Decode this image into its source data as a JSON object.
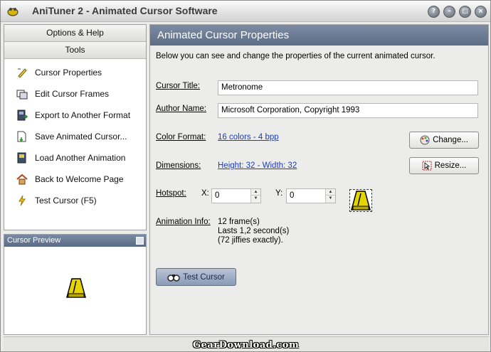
{
  "window": {
    "title": "AniTuner 2 - Animated Cursor Software"
  },
  "sidebar": {
    "header_options": "Options & Help",
    "header_tools": "Tools",
    "items": [
      {
        "label": "Cursor Properties",
        "icon": "properties-icon"
      },
      {
        "label": "Edit Cursor Frames",
        "icon": "frames-icon"
      },
      {
        "label": "Export to Another Format",
        "icon": "export-icon"
      },
      {
        "label": "Save Animated Cursor...",
        "icon": "save-icon"
      },
      {
        "label": "Load Another Animation",
        "icon": "load-icon"
      },
      {
        "label": "Back to Welcome Page",
        "icon": "home-icon"
      },
      {
        "label": "Test Cursor (F5)",
        "icon": "lightning-icon"
      }
    ]
  },
  "preview": {
    "title": "Cursor Preview"
  },
  "main": {
    "title": "Animated Cursor Properties",
    "intro": "Below you can see and change the properties of the current animated cursor.",
    "cursor_title_label": "Cursor Title:",
    "cursor_title_value": "Metronome",
    "author_label": "Author Name:",
    "author_value": "Microsoft Corporation, Copyright 1993",
    "color_label": "Color Format:",
    "color_value": "16 colors - 4 bpp",
    "change_button": "Change...",
    "dimensions_label": "Dimensions:",
    "dimensions_value": "Height: 32 - Width: 32",
    "resize_button": "Resize...",
    "hotspot_label": "Hotspot:",
    "x_label": "X:",
    "x_value": "0",
    "y_label": "Y:",
    "y_value": "0",
    "animation_label": "Animation Info:",
    "animation_frames": "12 frame(s)",
    "animation_duration": "Lasts 1,2 second(s)",
    "animation_jiffies": "(72 jiffies exactly).",
    "test_button": "Test Cursor"
  },
  "watermark": "GearDownload.com",
  "colors": {
    "panel_header": "#5e6d87",
    "link": "#1a3cc6",
    "metronome": "#e4d400"
  }
}
